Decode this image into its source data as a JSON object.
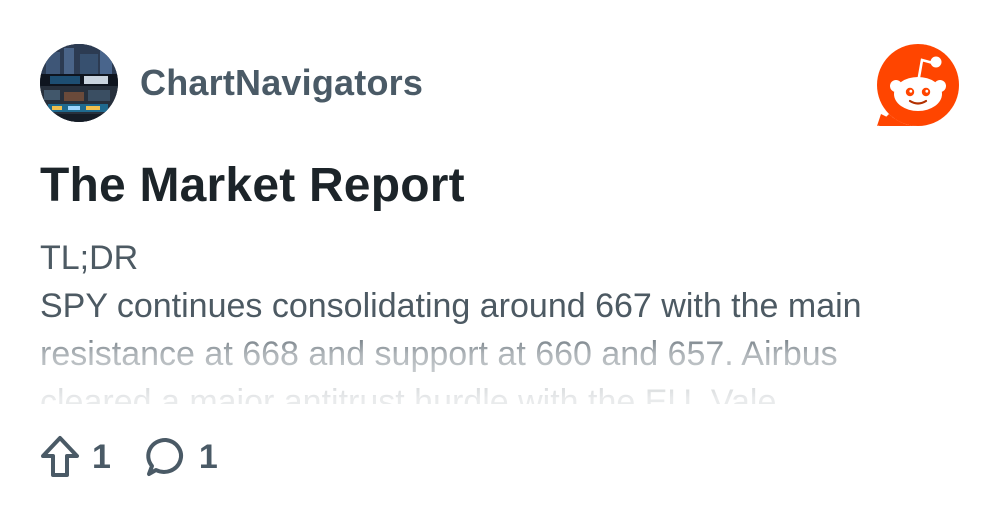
{
  "post": {
    "author": "ChartNavigators",
    "title": "The Market Report",
    "body_lines": [
      "TL;DR",
      "SPY continues consolidating around 667 with the main",
      "resistance at 668 and support at 660 and 657. Airbus",
      "cleared a major antitrust hurdle with the EU. Vale"
    ],
    "upvotes": "1",
    "comments": "1"
  },
  "icons": {
    "avatar": "stock-exchange-avatar",
    "logo": "reddit-logo-icon",
    "upvote": "upvote-arrow-icon",
    "comment": "comment-bubble-icon"
  },
  "colors": {
    "brand": "#ff4500",
    "text_dark": "#1c2429",
    "text_muted": "#4a5a66"
  }
}
